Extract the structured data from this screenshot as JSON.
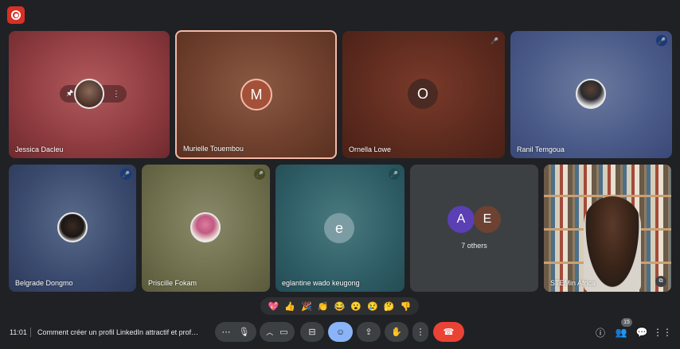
{
  "call": {
    "time": "11:01",
    "title": "Comment créer un profil LinkedIn attractif et prof…",
    "participants_count": "15"
  },
  "tiles": [
    {
      "name": "Jessica Dacleu",
      "kind": "photo"
    },
    {
      "name": "Murielle Touembou",
      "avatar_letter": "M"
    },
    {
      "name": "Ornella Lowe",
      "avatar_letter": "O"
    },
    {
      "name": "Ranil Temgoua",
      "kind": "photo"
    },
    {
      "name": "Belgrade Dongmo",
      "kind": "photo"
    },
    {
      "name": "Priscille Fokam",
      "kind": "photo"
    },
    {
      "name": "eglantine wado keugong",
      "avatar_letter": "e"
    },
    {
      "name": "7 others",
      "avatars": [
        "A",
        "E"
      ]
    },
    {
      "name": "STEMin Africa",
      "kind": "video"
    }
  ],
  "reactions": [
    "💖",
    "👍",
    "🎉",
    "👏",
    "😂",
    "😮",
    "😢",
    "🤔",
    "👎"
  ],
  "colors": {
    "accent": "#8ab4f8",
    "hangup": "#ea4335",
    "record": "#d93025"
  }
}
